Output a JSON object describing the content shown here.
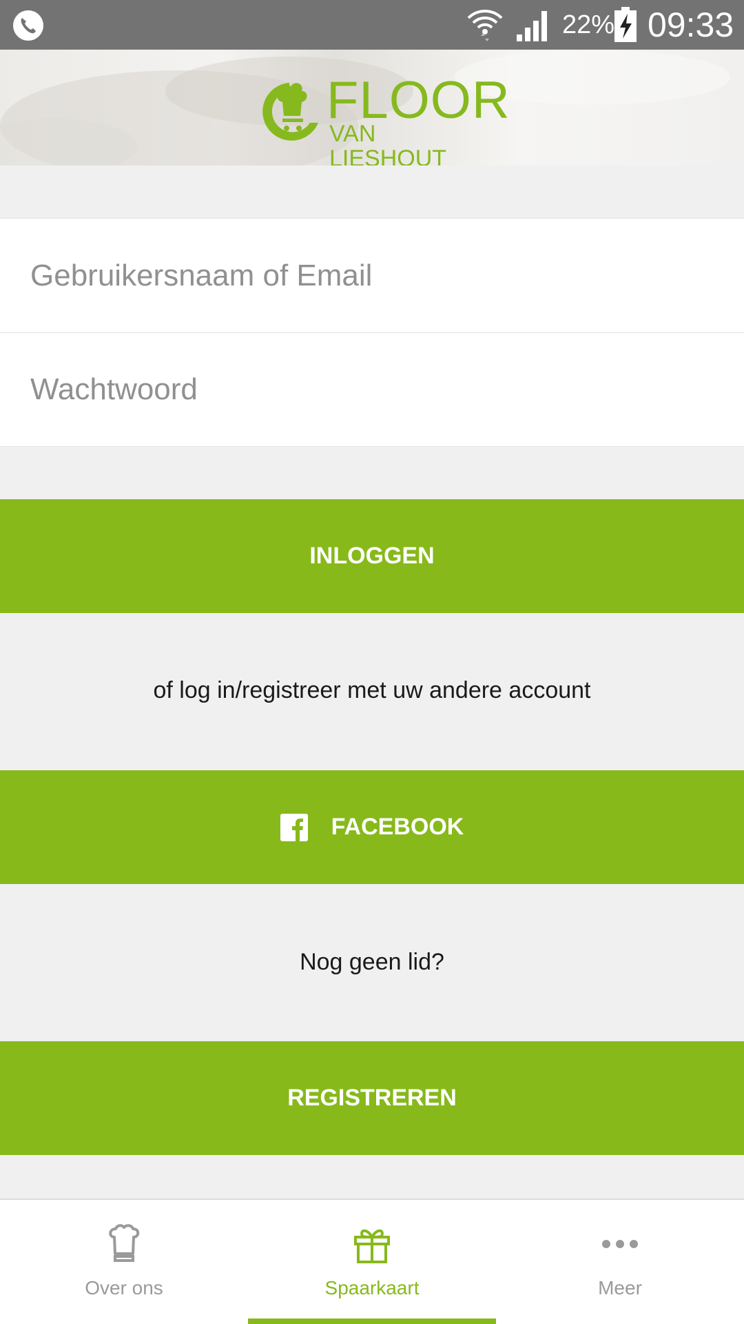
{
  "status_bar": {
    "battery_percent": "22%",
    "time": "09:33",
    "icons": [
      "phone-icon",
      "wifi-icon",
      "signal-icon",
      "battery-charging-icon"
    ]
  },
  "header": {
    "logo_word": "FLOOR",
    "logo_sub": "VAN LIESHOUT",
    "logo_icon": "chef-hat-cart-logo"
  },
  "form": {
    "username_placeholder": "Gebruikersnaam of Email",
    "username_value": "",
    "password_placeholder": "Wachtwoord",
    "password_value": ""
  },
  "buttons": {
    "login_label": "INLOGGEN",
    "facebook_label": "FACEBOOK",
    "register_label": "REGISTREREN"
  },
  "notes": {
    "alt_login": "of log in/registreer met uw andere account",
    "not_member": "Nog geen lid?"
  },
  "bottom_nav": {
    "items": [
      {
        "label": "Over ons",
        "icon": "chef-hat-icon",
        "active": false
      },
      {
        "label": "Spaarkaart",
        "icon": "gift-icon",
        "active": true
      },
      {
        "label": "Meer",
        "icon": "more-dots-icon",
        "active": false
      }
    ]
  },
  "colors": {
    "accent": "#87b91b",
    "status_bar": "#737373",
    "background": "#f0f0f0",
    "inactive_nav": "#9a9a9a"
  }
}
